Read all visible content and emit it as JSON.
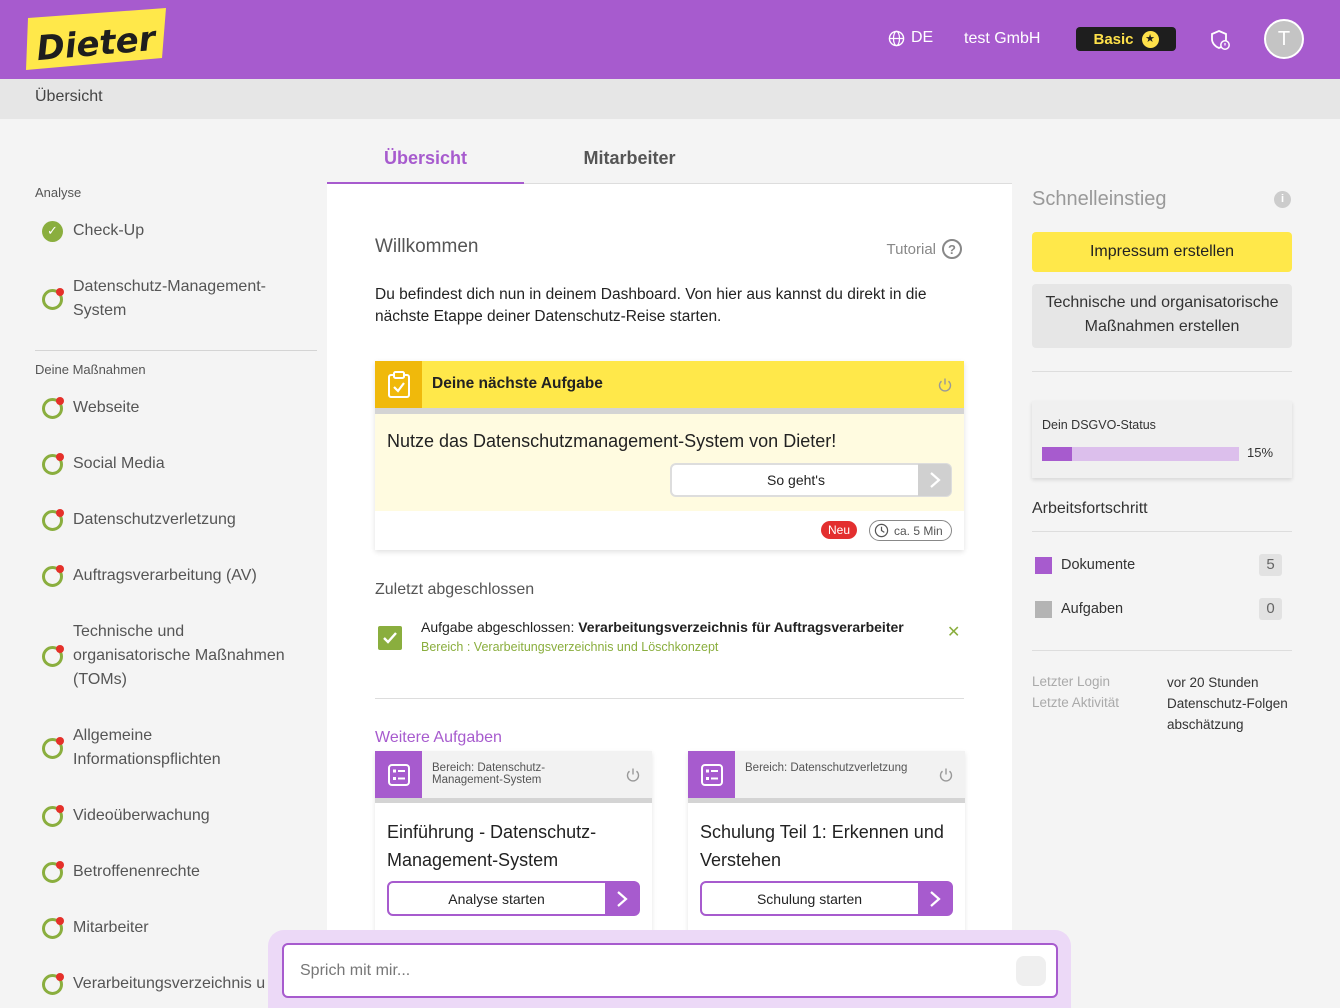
{
  "header": {
    "logo_text": "Dieter",
    "language": "DE",
    "company": "test GmbH",
    "plan": "Basic",
    "avatar_initial": "T",
    "accent_color": "#a75bce",
    "logo_color": "#ffe84a"
  },
  "breadcrumb": "Übersicht",
  "sidebar": {
    "section_analyse": "Analyse",
    "checkup": "Check-Up",
    "dsms": "Datenschutz-Management-System",
    "section_measures": "Deine Maßnahmen",
    "items": [
      "Webseite",
      "Social Media",
      "Datenschutzverletzung",
      "Auftragsverarbeitung (AV)",
      "Technische und organisatorische Maßnahmen (TOMs)",
      "Allgemeine Informationspflichten",
      "Videoüberwachung",
      "Betroffenenrechte",
      "Mitarbeiter",
      "Verarbeitungsverzeichnis u"
    ]
  },
  "tabs": {
    "overview": "Übersicht",
    "employees": "Mitarbeiter"
  },
  "main": {
    "welcome": "Willkommen",
    "tutorial": "Tutorial",
    "intro": "Du befindest dich nun in deinem Dashboard. Von hier aus kannst du direkt in die nächste Etappe deiner Datenschutz-Reise starten.",
    "next_task": {
      "header": "Deine nächste Aufgabe",
      "text": "Nutze das Datenschutzmanagement-System von Dieter!",
      "button": "So geht's",
      "badge_new": "Neu",
      "duration": "ca. 5 Min"
    },
    "last_completed": {
      "title": "Zuletzt abgeschlossen",
      "prefix": "Aufgabe abgeschlossen:",
      "task": "Verarbeitungsverzeichnis für Auftragsverarbeiter",
      "area": "Bereich : Verarbeitungsverzeichnis und Löschkonzept"
    },
    "more_tasks": {
      "title": "Weitere Aufgaben",
      "cards": [
        {
          "area": "Bereich: Datenschutz-Management-System",
          "title": "Einführung - Datenschutz-Management-System",
          "button": "Analyse starten"
        },
        {
          "area": "Bereich: Datenschutzverletzung",
          "title": "Schulung Teil 1: Erkennen und Verstehen",
          "button": "Schulung starten"
        }
      ]
    }
  },
  "right": {
    "quickstart_title": "Schnelleinstieg",
    "btn_impressum": "Impressum erstellen",
    "btn_toms": "Technische und organisatorische Maßnahmen erstellen",
    "status_label": "Dein DSGVO-Status",
    "status_percent": 15,
    "status_text": "15%",
    "progress_title": "Arbeitsfortschritt",
    "legend": [
      {
        "label": "Dokumente",
        "count": "5",
        "color": "#a75bce"
      },
      {
        "label": "Aufgaben",
        "count": "0",
        "color": "#b4b4b4"
      }
    ],
    "last_login_label": "Letzter Login",
    "last_login_value": "vor 20 Stunden",
    "last_activity_label": "Letzte Aktivität",
    "last_activity_value": "Datenschutz-Folgenabschätzung"
  },
  "chat": {
    "placeholder": "Sprich mit mir..."
  }
}
